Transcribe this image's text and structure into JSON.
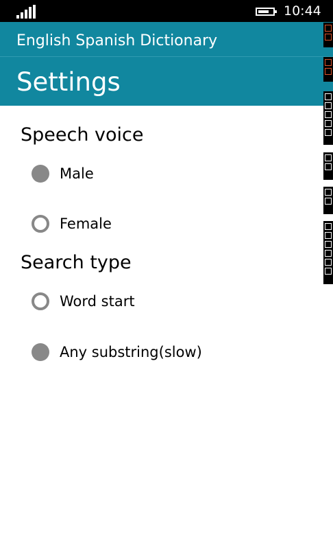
{
  "status_bar": {
    "time": "10:44",
    "signal_icon": "signal-bars-icon",
    "battery_icon": "battery-icon",
    "battery_level": 0.75
  },
  "header": {
    "app_title": "English Spanish Dictionary",
    "page_title": "Settings",
    "color": "#11879f"
  },
  "settings": {
    "speech_voice": {
      "heading": "Speech voice",
      "options": [
        {
          "label": "Male",
          "selected": true
        },
        {
          "label": "Female",
          "selected": false
        }
      ]
    },
    "search_type": {
      "heading": "Search type",
      "options": [
        {
          "label": "Word start",
          "selected": false
        },
        {
          "label": "Any substring(slow)",
          "selected": true
        }
      ]
    }
  },
  "colors": {
    "radio": "#888888",
    "text": "#000000",
    "background": "#ffffff"
  }
}
